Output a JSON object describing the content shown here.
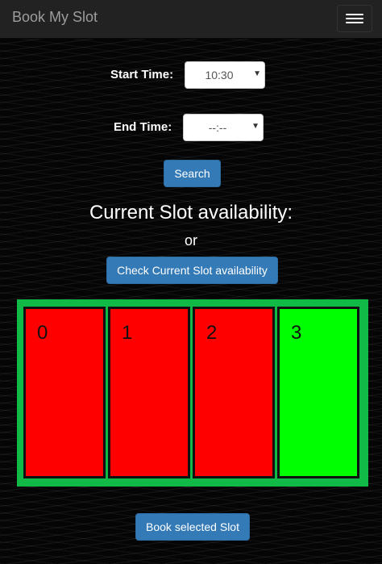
{
  "navbar": {
    "brand": "Book My Slot",
    "menu_icon": "hamburger-menu-icon"
  },
  "form": {
    "start_label": "Start Time:",
    "start_value": "10:30",
    "end_label": "End Time:",
    "end_value": "--:--",
    "search_label": "Search"
  },
  "availability": {
    "heading": "Current Slot availability:",
    "or_text": "or",
    "check_label": "Check Current Slot availability"
  },
  "slots": [
    {
      "number": "0",
      "status": "occupied",
      "color": "#ff0000"
    },
    {
      "number": "1",
      "status": "occupied",
      "color": "#ff0000"
    },
    {
      "number": "2",
      "status": "occupied",
      "color": "#ff0000"
    },
    {
      "number": "3",
      "status": "available",
      "color": "#00ff00"
    }
  ],
  "footer": {
    "book_label": "Book selected Slot"
  },
  "colors": {
    "navbar_bg": "#222222",
    "primary_button": "#337ab7",
    "slots_container": "#11b947",
    "occupied": "#ff0000",
    "available": "#00ff00"
  }
}
